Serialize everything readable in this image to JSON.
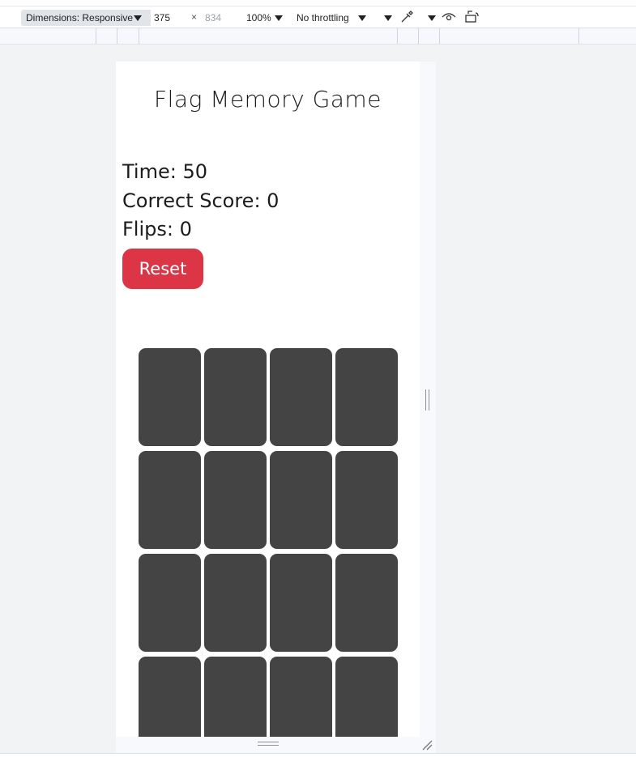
{
  "devtools": {
    "dimensions_label": "Dimensions: Responsive",
    "width_value": "375",
    "height_placeholder": "834",
    "times_symbol": "×",
    "zoom": "100%",
    "throttling": "No throttling"
  },
  "game": {
    "title": "Flag Memory Game",
    "time_text": "Time: 50",
    "score_text": "Correct Score: 0",
    "flips_text": "Flips: 0",
    "reset_label": "Reset",
    "card_color": "#444444",
    "reset_color": "#dc3545",
    "card_count": 16
  }
}
